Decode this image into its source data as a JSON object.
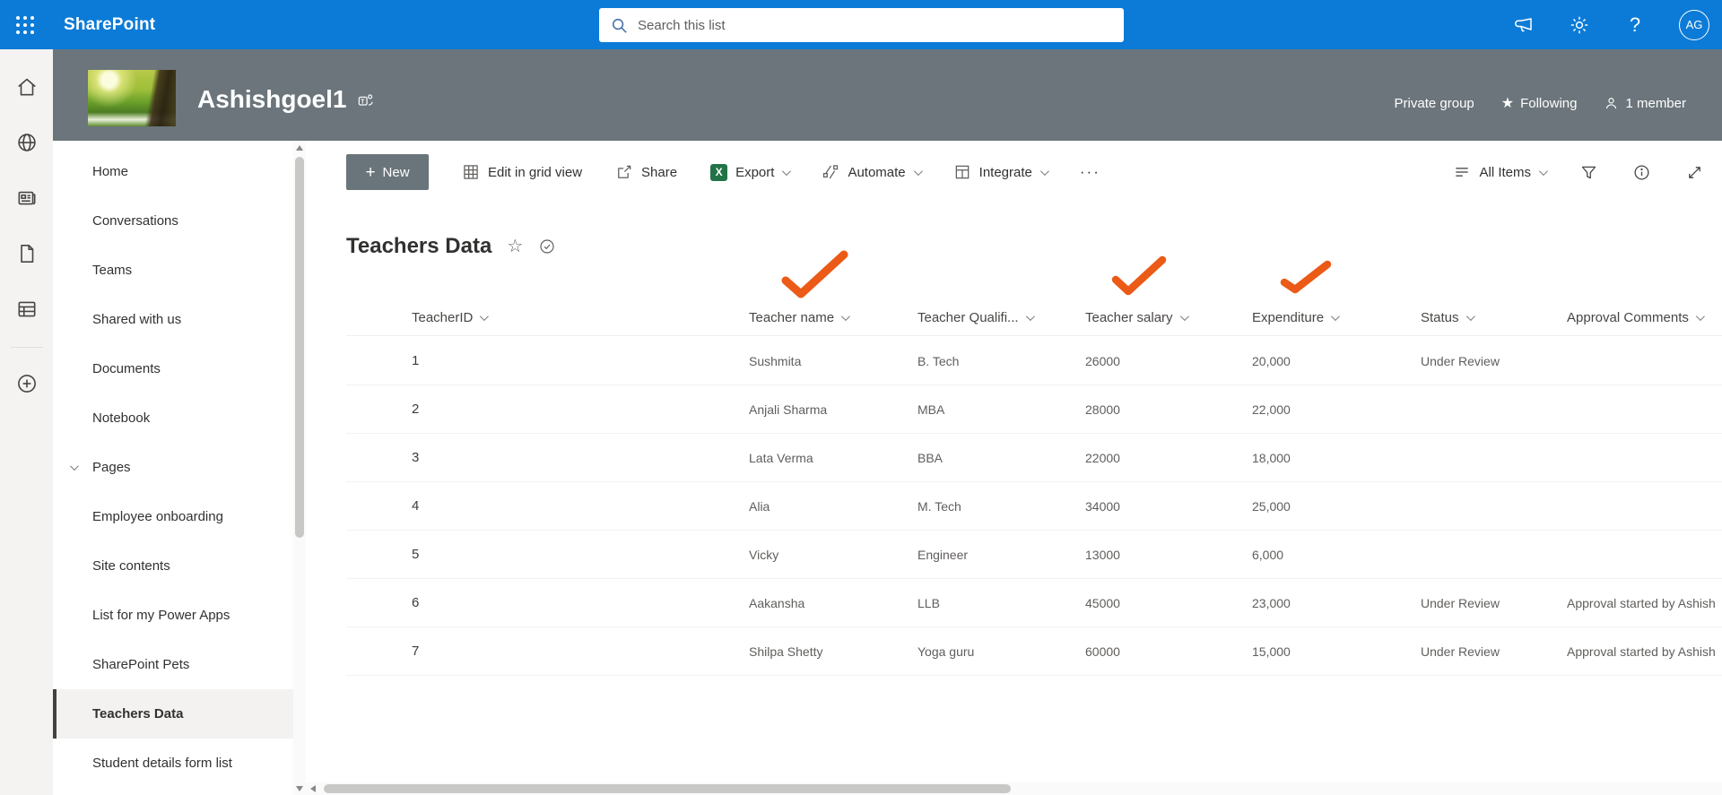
{
  "suite_bar": {
    "app_name": "SharePoint",
    "search_placeholder": "Search this list",
    "avatar_initials": "AG"
  },
  "site_header": {
    "title": "Ashishgoel1",
    "privacy_label": "Private group",
    "following_label": "Following",
    "members_label": "1 member"
  },
  "sidebar": {
    "items": [
      {
        "label": "Home"
      },
      {
        "label": "Conversations"
      },
      {
        "label": "Teams"
      },
      {
        "label": "Shared with us"
      },
      {
        "label": "Documents"
      },
      {
        "label": "Notebook"
      },
      {
        "label": "Pages",
        "expandable": true
      },
      {
        "label": "Employee onboarding"
      },
      {
        "label": "Site contents"
      },
      {
        "label": "List for my Power Apps"
      },
      {
        "label": "SharePoint Pets"
      },
      {
        "label": "Teachers Data",
        "selected": true
      },
      {
        "label": "Student details form list"
      }
    ]
  },
  "toolbar": {
    "new_label": "New",
    "edit_grid_label": "Edit in grid view",
    "share_label": "Share",
    "export_label": "Export",
    "automate_label": "Automate",
    "integrate_label": "Integrate",
    "more_label": "···",
    "view_label": "All Items"
  },
  "list": {
    "title": "Teachers Data",
    "columns": [
      "TeacherID",
      "Teacher name",
      "Teacher Qualifi...",
      "Teacher salary",
      "Expenditure",
      "Status",
      "Approval Comments"
    ],
    "rows": [
      {
        "id": "1",
        "name": "Sushmita",
        "qualification": "B. Tech",
        "salary": "26000",
        "expenditure": "20,000",
        "status": "Under Review",
        "approval": ""
      },
      {
        "id": "2",
        "name": "Anjali Sharma",
        "qualification": "MBA",
        "salary": "28000",
        "expenditure": "22,000",
        "status": "",
        "approval": ""
      },
      {
        "id": "3",
        "name": "Lata Verma",
        "qualification": "BBA",
        "salary": "22000",
        "expenditure": "18,000",
        "status": "",
        "approval": ""
      },
      {
        "id": "4",
        "name": "Alia",
        "qualification": "M. Tech",
        "salary": "34000",
        "expenditure": "25,000",
        "status": "",
        "approval": ""
      },
      {
        "id": "5",
        "name": "Vicky",
        "qualification": "Engineer",
        "salary": "13000",
        "expenditure": "6,000",
        "status": "",
        "approval": ""
      },
      {
        "id": "6",
        "name": "Aakansha",
        "qualification": "LLB",
        "salary": "45000",
        "expenditure": "23,000",
        "status": "Under Review",
        "approval": "Approval started by Ashish"
      },
      {
        "id": "7",
        "name": "Shilpa Shetty",
        "qualification": "Yoga guru",
        "salary": "60000",
        "expenditure": "15,000",
        "status": "Under Review",
        "approval": "Approval started by Ashish"
      }
    ]
  },
  "annotations": {
    "checked_columns": [
      "Teacher name",
      "Teacher salary",
      "Expenditure"
    ],
    "highlight_color": "#eb5a17"
  },
  "colors": {
    "suite_bar_blue": "#0b7bd7",
    "site_header_slate": "#6b757b",
    "annotation_orange": "#eb5a17",
    "excel_green": "#217346",
    "selected_nav_bg": "#f3f2f1"
  }
}
